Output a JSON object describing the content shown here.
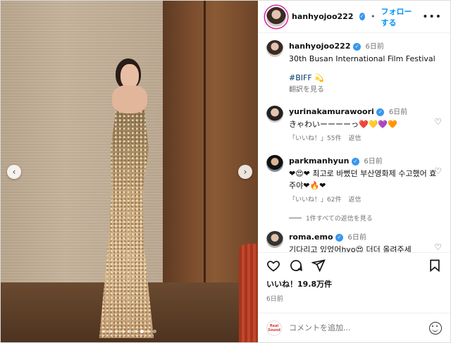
{
  "post": {
    "carousel": {
      "total_slides": 9,
      "active_slide": 7
    },
    "header": {
      "username": "hanhyojoo222",
      "follow_label": "フォローする",
      "separator": "•",
      "more_icon": "more-horizontal-icon"
    },
    "caption": {
      "username": "hanhyojoo222",
      "time": "6日前",
      "text": "30th Busan International Film Festival",
      "hashtag": "#BIFF 💫",
      "translate_label": "翻訳を見る"
    },
    "comments": [
      {
        "username": "yurinakamurawoori",
        "verified": true,
        "time": "6日前",
        "text": "きゃわいーーーーっ❤️💛💜🧡",
        "likes_label": "「いいね！」55件",
        "reply_label": "返信"
      },
      {
        "username": "parkmanhyun",
        "verified": true,
        "time": "6日前",
        "text": "❤😍❤ 최고로 바뻤던 부산영화제 수고했어 효주야❤🔥❤",
        "likes_label": "「いいね！」62件",
        "reply_label": "返信",
        "view_replies_label": "1件すべての返信を見る"
      },
      {
        "username": "roma.emo",
        "verified": true,
        "time": "6日前",
        "text": "기다리고 있었어hyo😍 더더 올려주세"
      }
    ],
    "likes_label": "いいね！19.8万件",
    "date_label": "6日前",
    "add_comment": {
      "placeholder": "コメントを追加...",
      "logo_text": "Real Sound"
    },
    "colors": {
      "accent": "#0095f6",
      "verified": "#3897f0",
      "secondary_text": "#737373"
    }
  }
}
